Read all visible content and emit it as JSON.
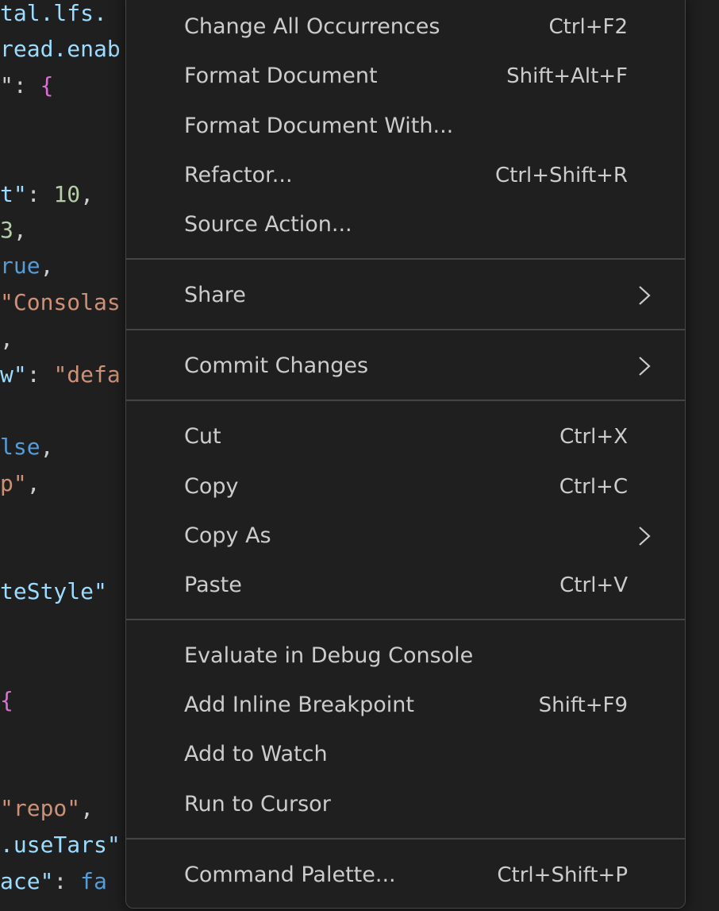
{
  "editor": {
    "lines": [
      [
        {
          "t": "tal.lfs.",
          "c": "key"
        }
      ],
      [
        {
          "t": "read.enab",
          "c": "key"
        }
      ],
      [
        {
          "t": "\": ",
          "c": "punc"
        },
        {
          "t": "{",
          "c": "brace"
        }
      ],
      [
        {
          "t": "t\"",
          "c": "key"
        },
        {
          "t": ": ",
          "c": "punc"
        },
        {
          "t": "10",
          "c": "num"
        },
        {
          "t": ",",
          "c": "punc"
        }
      ],
      [
        {
          "t": "3",
          "c": "num"
        },
        {
          "t": ",",
          "c": "punc"
        }
      ],
      [
        {
          "t": "rue",
          "c": "kw"
        },
        {
          "t": ",",
          "c": "punc"
        }
      ],
      [
        {
          "t": "\"Consolas",
          "c": "str"
        }
      ],
      [
        {
          "t": ",",
          "c": "punc"
        }
      ],
      [
        {
          "t": "w\"",
          "c": "key"
        },
        {
          "t": ": ",
          "c": "punc"
        },
        {
          "t": "\"defa",
          "c": "str"
        }
      ],
      [
        {
          "t": "lse",
          "c": "kw"
        },
        {
          "t": ",",
          "c": "punc"
        }
      ],
      [
        {
          "t": "p\"",
          "c": "str"
        },
        {
          "t": ",",
          "c": "punc"
        }
      ],
      [
        {
          "t": "teStyle\"",
          "c": "key"
        }
      ],
      [
        {
          "t": "{",
          "c": "brace"
        }
      ],
      [
        {
          "t": "\"repo\"",
          "c": "str"
        },
        {
          "t": ", ",
          "c": "punc"
        }
      ],
      [
        {
          "t": ".useTars\"",
          "c": "key"
        }
      ],
      [
        {
          "t": "ace\"",
          "c": "key"
        },
        {
          "t": ": ",
          "c": "punc"
        },
        {
          "t": "fa",
          "c": "kw"
        }
      ]
    ]
  },
  "context_menu": {
    "items": [
      {
        "label": "Change All Occurrences",
        "shortcut": "Ctrl+F2",
        "submenu": false
      },
      {
        "label": "Format Document",
        "shortcut": "Shift+Alt+F",
        "submenu": false
      },
      {
        "label": "Format Document With...",
        "shortcut": "",
        "submenu": false
      },
      {
        "label": "Refactor...",
        "shortcut": "Ctrl+Shift+R",
        "submenu": false
      },
      {
        "label": "Source Action...",
        "shortcut": "",
        "submenu": false
      },
      {
        "separator": true
      },
      {
        "label": "Share",
        "shortcut": "",
        "submenu": true
      },
      {
        "separator": true
      },
      {
        "label": "Commit Changes",
        "shortcut": "",
        "submenu": true
      },
      {
        "separator": true
      },
      {
        "label": "Cut",
        "shortcut": "Ctrl+X",
        "submenu": false
      },
      {
        "label": "Copy",
        "shortcut": "Ctrl+C",
        "submenu": false
      },
      {
        "label": "Copy As",
        "shortcut": "",
        "submenu": true
      },
      {
        "label": "Paste",
        "shortcut": "Ctrl+V",
        "submenu": false
      },
      {
        "separator": true
      },
      {
        "label": "Evaluate in Debug Console",
        "shortcut": "",
        "submenu": false
      },
      {
        "label": "Add Inline Breakpoint",
        "shortcut": "Shift+F9",
        "submenu": false
      },
      {
        "label": "Add to Watch",
        "shortcut": "",
        "submenu": false
      },
      {
        "label": "Run to Cursor",
        "shortcut": "",
        "submenu": false
      },
      {
        "separator": true
      },
      {
        "label": "Command Palette...",
        "shortcut": "Ctrl+Shift+P",
        "submenu": false
      }
    ]
  },
  "icons": {
    "submenu": "chevron-right-icon"
  }
}
